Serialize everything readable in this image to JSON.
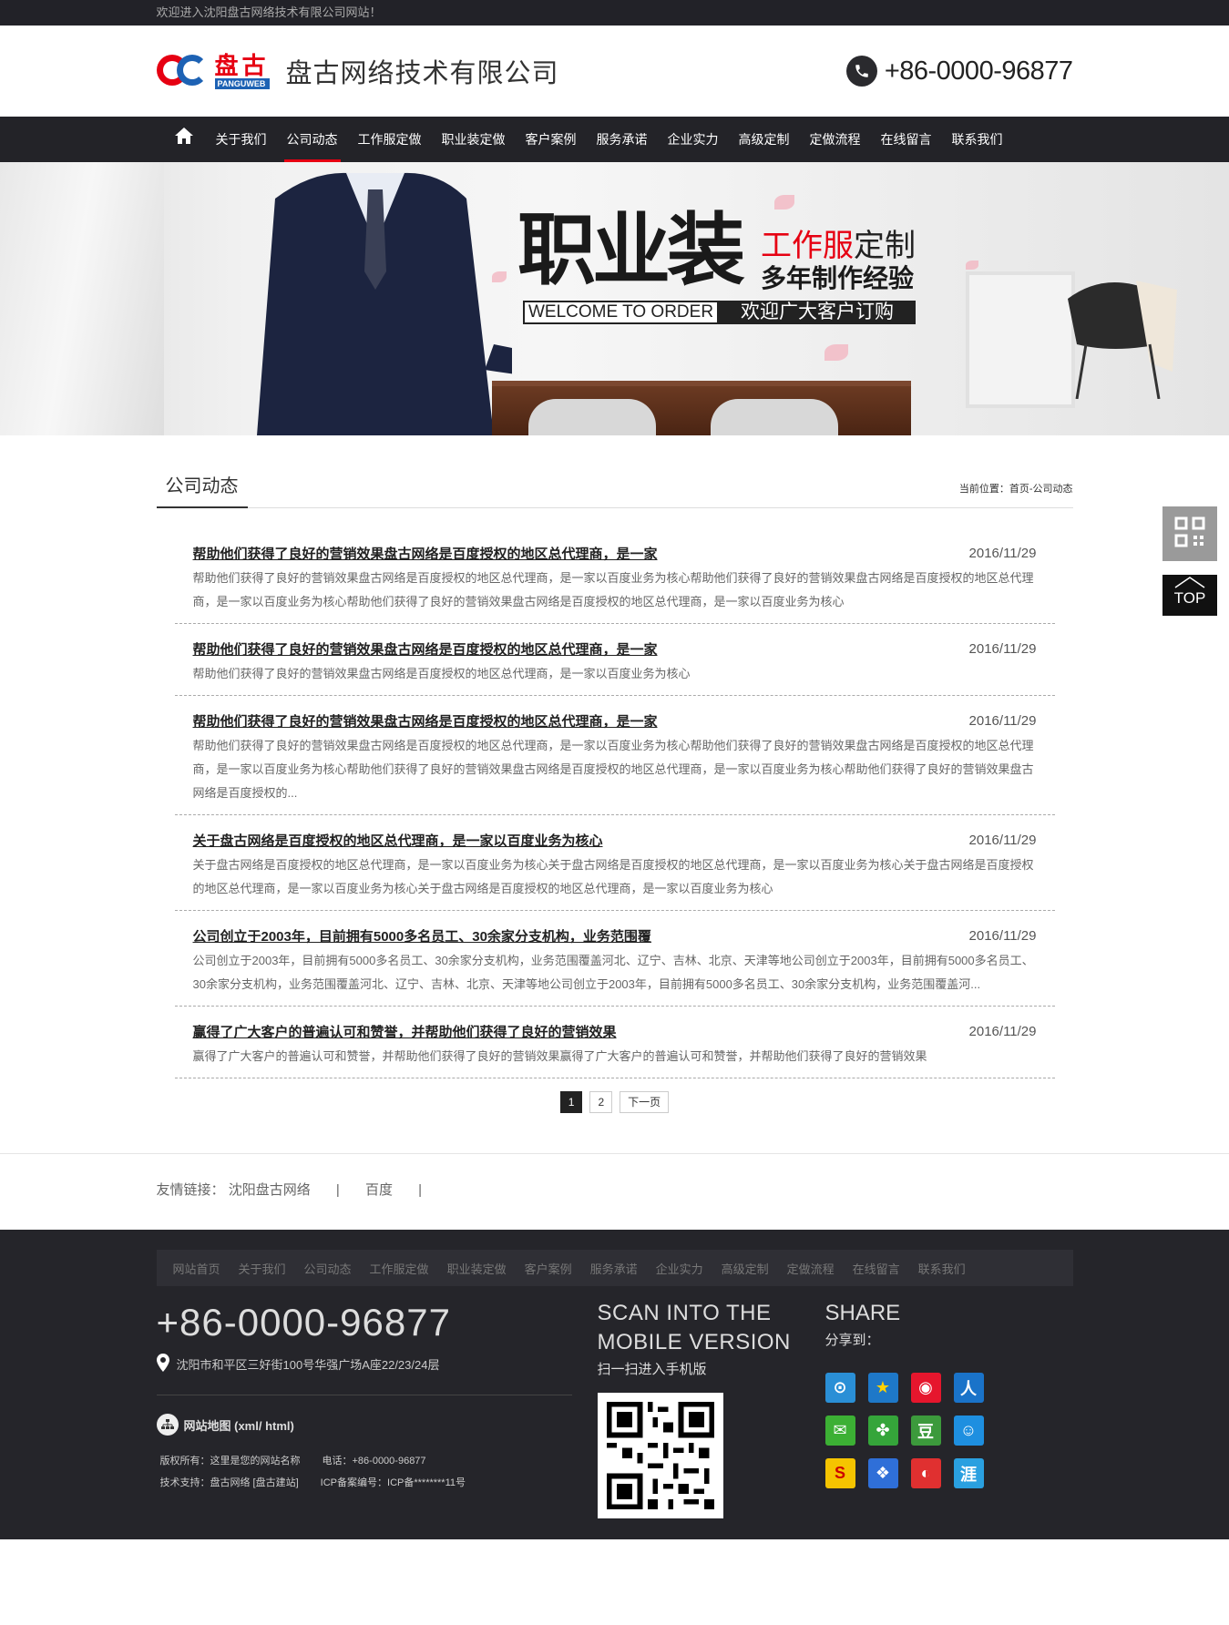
{
  "topbar": {
    "welcome": "欢迎进入沈阳盘古网络技术有限公司网站！"
  },
  "header": {
    "logo_cn": "盘古",
    "logo_en": "PANGUWEB",
    "company": "盘古网络技术有限公司",
    "phone": "+86-0000-96877"
  },
  "nav": {
    "items": [
      "关于我们",
      "公司动态",
      "工作服定做",
      "职业装定做",
      "客户案例",
      "服务承诺",
      "企业实力",
      "高级定制",
      "定做流程",
      "在线留言",
      "联系我们"
    ],
    "active": "公司动态"
  },
  "banner": {
    "title": "职业装",
    "sub1_red": "工作服",
    "sub1_black": "定制",
    "sub2": "多年制作经验",
    "welcome_en": "WELCOME TO ORDER",
    "welcome_cn": "欢迎广大客户订购"
  },
  "main": {
    "section_title": "公司动态",
    "breadcrumb": "当前位置：首页-公司动态",
    "articles": [
      {
        "title": "帮助他们获得了良好的营销效果盘古网络是百度授权的地区总代理商，是一家",
        "date": "2016/11/29",
        "summary": "帮助他们获得了良好的营销效果盘古网络是百度授权的地区总代理商，是一家以百度业务为核心帮助他们获得了良好的营销效果盘古网络是百度授权的地区总代理商，是一家以百度业务为核心帮助他们获得了良好的营销效果盘古网络是百度授权的地区总代理商，是一家以百度业务为核心"
      },
      {
        "title": "帮助他们获得了良好的营销效果盘古网络是百度授权的地区总代理商，是一家",
        "date": "2016/11/29",
        "summary": "帮助他们获得了良好的营销效果盘古网络是百度授权的地区总代理商，是一家以百度业务为核心"
      },
      {
        "title": "帮助他们获得了良好的营销效果盘古网络是百度授权的地区总代理商，是一家",
        "date": "2016/11/29",
        "summary": "帮助他们获得了良好的营销效果盘古网络是百度授权的地区总代理商，是一家以百度业务为核心帮助他们获得了良好的营销效果盘古网络是百度授权的地区总代理商，是一家以百度业务为核心帮助他们获得了良好的营销效果盘古网络是百度授权的地区总代理商，是一家以百度业务为核心帮助他们获得了良好的营销效果盘古网络是百度授权的..."
      },
      {
        "title": "关于盘古网络是百度授权的地区总代理商，是一家以百度业务为核心",
        "date": "2016/11/29",
        "summary": "关于盘古网络是百度授权的地区总代理商，是一家以百度业务为核心关于盘古网络是百度授权的地区总代理商，是一家以百度业务为核心关于盘古网络是百度授权的地区总代理商，是一家以百度业务为核心关于盘古网络是百度授权的地区总代理商，是一家以百度业务为核心"
      },
      {
        "title": "公司创立于2003年，目前拥有5000多名员工、30余家分支机构，业务范围覆",
        "date": "2016/11/29",
        "summary": "公司创立于2003年，目前拥有5000多名员工、30余家分支机构，业务范围覆盖河北、辽宁、吉林、北京、天津等地公司创立于2003年，目前拥有5000多名员工、30余家分支机构，业务范围覆盖河北、辽宁、吉林、北京、天津等地公司创立于2003年，目前拥有5000多名员工、30余家分支机构，业务范围覆盖河..."
      },
      {
        "title": "赢得了广大客户的普遍认可和赞誉，并帮助他们获得了良好的营销效果",
        "date": "2016/11/29",
        "summary": "赢得了广大客户的普遍认可和赞誉，并帮助他们获得了良好的营销效果赢得了广大客户的普遍认可和赞誉，并帮助他们获得了良好的营销效果"
      }
    ],
    "pager": {
      "p1": "1",
      "p2": "2",
      "next": "下一页"
    }
  },
  "links": {
    "label": "友情链接：",
    "items": [
      "沈阳盘古网络",
      "百度"
    ],
    "sep": "|"
  },
  "footer": {
    "nav": [
      "网站首页",
      "关于我们",
      "公司动态",
      "工作服定做",
      "职业装定做",
      "客户案例",
      "服务承诺",
      "企业实力",
      "高级定制",
      "定做流程",
      "在线留言",
      "联系我们"
    ],
    "phone": "+86-0000-96877",
    "address": "沈阳市和平区三好街100号华强广场A座22/23/24层",
    "sitemap": "网站地图 (xml/ html)",
    "copyright": "版权所有：这里是您的网站名称",
    "tel": "电话：+86-0000-96877",
    "support": "技术支持：盘古网络 [盘古建站]",
    "icp": "ICP备案编号：ICP备********11号",
    "scan_title1": "SCAN INTO THE",
    "scan_title2": "MOBILE VERSION",
    "scan_sub": "扫一扫进入手机版",
    "share_title": "SHARE",
    "share_sub": "分享到："
  },
  "side": {
    "top_label": "TOP"
  },
  "colors": {
    "accent": "#e60012",
    "dark": "#232328",
    "brand_blue": "#1d62b4"
  }
}
